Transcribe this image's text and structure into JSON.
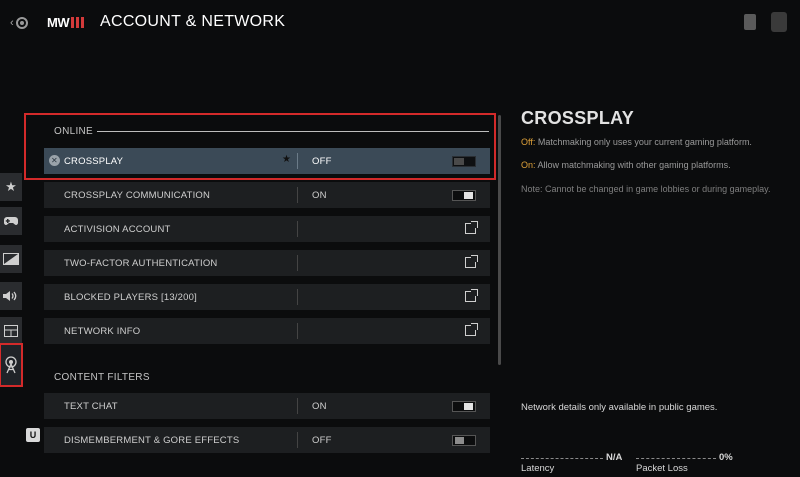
{
  "header": {
    "logo_text": "MW",
    "title": "ACCOUNT & NETWORK"
  },
  "rail": {
    "items": [
      {
        "icon": "star-icon",
        "glyph": "★"
      },
      {
        "icon": "controller-icon",
        "glyph": "🎮"
      },
      {
        "icon": "display-icon",
        "glyph": "◩"
      },
      {
        "icon": "speaker-icon",
        "glyph": "🔊"
      },
      {
        "icon": "interface-icon",
        "glyph": "▤"
      },
      {
        "icon": "network-icon",
        "glyph": "⍝",
        "active": true
      }
    ],
    "bottom_badge": "U"
  },
  "sections": {
    "online": "ONLINE",
    "content_filters": "CONTENT FILTERS"
  },
  "rows": {
    "crossplay": {
      "label": "CROSSPLAY",
      "value": "OFF",
      "toggle": "off"
    },
    "crossplay_comm": {
      "label": "CROSSPLAY COMMUNICATION",
      "value": "ON",
      "toggle": "on"
    },
    "activision": {
      "label": "ACTIVISION ACCOUNT"
    },
    "two_factor": {
      "label": "TWO-FACTOR AUTHENTICATION"
    },
    "blocked": {
      "label": "BLOCKED PLAYERS [13/200]"
    },
    "network_info": {
      "label": "NETWORK INFO"
    },
    "text_chat": {
      "label": "TEXT CHAT",
      "value": "ON",
      "toggle": "on"
    },
    "gore": {
      "label": "DISMEMBERMENT & GORE EFFECTS",
      "value": "OFF",
      "toggle": "off"
    }
  },
  "detail": {
    "title": "CROSSPLAY",
    "off_key": "Off:",
    "off_text": " Matchmaking only uses your current gaming platform.",
    "on_key": "On:",
    "on_text": " Allow matchmaking with other gaming platforms.",
    "note": "Note: Cannot be changed in game lobbies or during gameplay."
  },
  "network": {
    "note": "Network details only available in public games.",
    "latency_value": "N/A",
    "latency_label": "Latency",
    "packet_value": "0%",
    "packet_label": "Packet Loss"
  },
  "colors": {
    "accent_red": "#d32a2a",
    "selected_row": "#3b4a57",
    "highlight_key": "#e0a23a"
  }
}
